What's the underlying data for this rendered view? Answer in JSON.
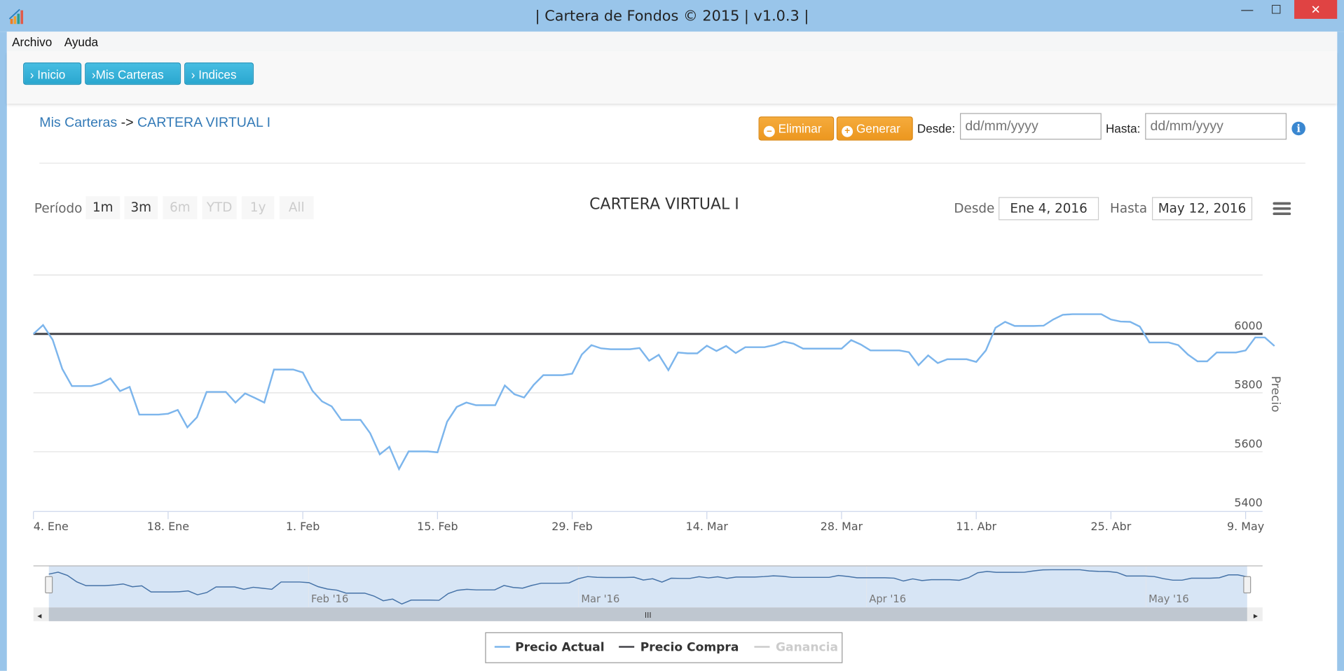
{
  "window": {
    "title": "| Cartera de Fondos © 2015 | v1.0.3 |",
    "minimize": "—",
    "maximize": "☐",
    "close": "✕"
  },
  "menu": [
    "Archivo",
    "Ayuda"
  ],
  "nav": [
    {
      "label": "Inicio"
    },
    {
      "label": "Mis Carteras"
    },
    {
      "label": "Indices"
    }
  ],
  "breadcrumb": {
    "parent": "Mis Carteras",
    "separator": "->",
    "current": "CARTERA VIRTUAL I"
  },
  "toolbar": {
    "eliminar": "Eliminar",
    "generar": "Generar",
    "desde_label": "Desde:",
    "hasta_label": "Hasta:",
    "desde_placeholder": "dd/mm/yyyy",
    "hasta_placeholder": "dd/mm/yyyy"
  },
  "range_selector": {
    "label": "Período",
    "buttons": [
      {
        "label": "1m",
        "enabled": true
      },
      {
        "label": "3m",
        "enabled": true
      },
      {
        "label": "6m",
        "enabled": false
      },
      {
        "label": "YTD",
        "enabled": false
      },
      {
        "label": "1y",
        "enabled": false
      },
      {
        "label": "All",
        "enabled": false
      }
    ],
    "desde_label": "Desde",
    "desde_value": "Ene 4, 2016",
    "hasta_label": "Hasta",
    "hasta_value": "May 12, 2016"
  },
  "chart_data": {
    "type": "line",
    "title": "CARTERA VIRTUAL I",
    "ylabel": "Precio",
    "ylim": [
      5400,
      6200
    ],
    "yticks": [
      "5400",
      "5600",
      "5800",
      "6000"
    ],
    "xticks": [
      "4. Ene",
      "18. Ene",
      "1. Feb",
      "15. Feb",
      "29. Feb",
      "14. Mar",
      "28. Mar",
      "11. Abr",
      "25. Abr",
      "9. May"
    ],
    "start_date": "2016-01-04",
    "interval": "1 day",
    "series": [
      {
        "name": "Precio Actual",
        "color": "#7cb5ec",
        "values": [
          6000,
          6030,
          5980,
          5881,
          5823,
          5823,
          5823,
          5832,
          5849,
          5806,
          5820,
          5726,
          5726,
          5726,
          5729,
          5742,
          5683,
          5717,
          5803,
          5803,
          5803,
          5767,
          5798,
          5783,
          5767,
          5879,
          5879,
          5879,
          5869,
          5807,
          5771,
          5754,
          5708,
          5708,
          5708,
          5663,
          5591,
          5617,
          5541,
          5601,
          5601,
          5601,
          5598,
          5702,
          5752,
          5767,
          5758,
          5758,
          5758,
          5825,
          5795,
          5784,
          5827,
          5860,
          5860,
          5860,
          5865,
          5930,
          5962,
          5951,
          5948,
          5948,
          5948,
          5952,
          5909,
          5929,
          5877,
          5937,
          5934,
          5934,
          5960,
          5942,
          5959,
          5935,
          5955,
          5955,
          5955,
          5962,
          5974,
          5967,
          5950,
          5950,
          5950,
          5950,
          5950,
          5979,
          5964,
          5944,
          5944,
          5944,
          5944,
          5938,
          5894,
          5927,
          5901,
          5914,
          5914,
          5914,
          5905,
          5944,
          6021,
          6041,
          6027,
          6027,
          6027,
          6028,
          6049,
          6065,
          6067,
          6067,
          6067,
          6067,
          6049,
          6042,
          6041,
          6025,
          5971,
          5971,
          5971,
          5962,
          5930,
          5907,
          5907,
          5937,
          5937,
          5937,
          5944,
          5988,
          5988,
          5959
        ]
      },
      {
        "name": "Precio Compra",
        "color": "#434348",
        "constant": 6000
      },
      {
        "name": "Ganancia",
        "color": "#cccccc",
        "hidden": true
      }
    ],
    "navigator_labels": [
      "Feb '16",
      "Mar '16",
      "Apr '16",
      "May '16"
    ],
    "legend_position": "bottom-center"
  }
}
